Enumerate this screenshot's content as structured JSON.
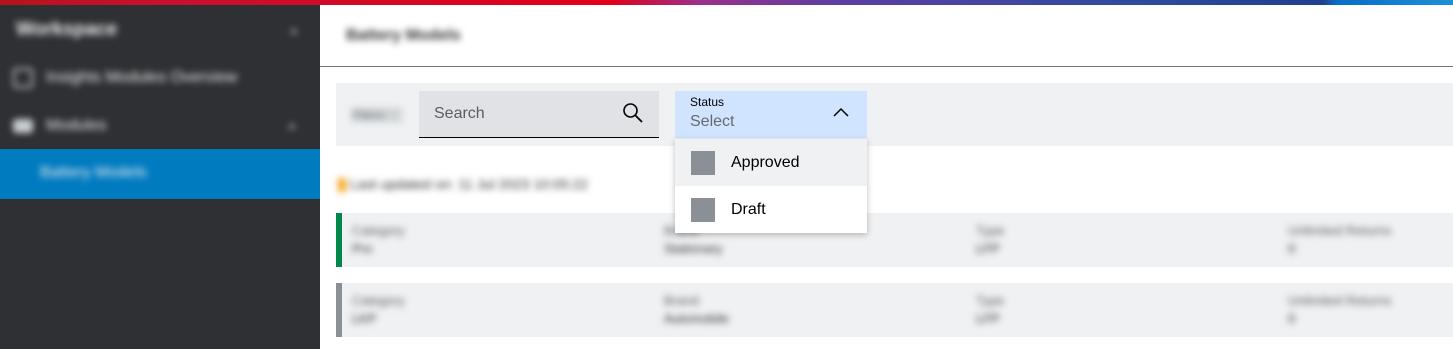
{
  "sidebar": {
    "title": "Workspace",
    "items": [
      {
        "label": "Insights Modules Overview",
        "icon": "document-icon"
      },
      {
        "label": "Modules",
        "icon": "box-icon"
      },
      {
        "label": "Battery Models",
        "active": true
      }
    ]
  },
  "header": {
    "title": "Battery Models"
  },
  "toolbar": {
    "filter_label": "Filters",
    "search": {
      "placeholder": "Search",
      "value": ""
    },
    "status": {
      "label": "Status",
      "placeholder": "Select"
    }
  },
  "dropdown": {
    "options": [
      "Approved",
      "Draft"
    ]
  },
  "updated": {
    "text": "Last updated on: 11 Jul 2023 10:05:22"
  },
  "cards": [
    {
      "accent": "#00884a",
      "cols": [
        {
          "label": "Category",
          "value": "Pro"
        },
        {
          "label": "Brand",
          "value": "Stationary"
        },
        {
          "label": "Type",
          "value": "LFP"
        },
        {
          "label": "Unlimited Returns",
          "value": "0"
        }
      ]
    },
    {
      "accent": "#8a9096",
      "cols": [
        {
          "label": "Category",
          "value": "LKP"
        },
        {
          "label": "Brand",
          "value": "Automobile"
        },
        {
          "label": "Type",
          "value": "LFP"
        },
        {
          "label": "Unlimited Returns",
          "value": "0"
        }
      ]
    }
  ],
  "colors": {
    "accent": "#007bc0",
    "sidebar_bg": "#2e3033",
    "select_bg": "#d1e4ff",
    "card_ok": "#00884a",
    "card_neutral": "#8a9096"
  }
}
